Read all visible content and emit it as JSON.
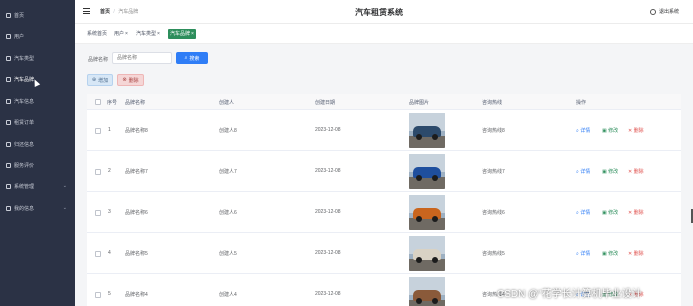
{
  "sidebar": {
    "items": [
      {
        "label": "首页",
        "icon": "home-icon"
      },
      {
        "label": "用户",
        "icon": "user-icon"
      },
      {
        "label": "汽车类型",
        "icon": "grid-icon"
      },
      {
        "label": "汽车品牌",
        "icon": "tag-icon"
      },
      {
        "label": "汽车信息",
        "icon": "grid-icon"
      },
      {
        "label": "租赁订单",
        "icon": "grid-icon"
      },
      {
        "label": "归还信息",
        "icon": "grid-icon"
      },
      {
        "label": "服务评价",
        "icon": "heart-icon"
      },
      {
        "label": "系统管理",
        "icon": "gear-icon"
      },
      {
        "label": "我的信息",
        "icon": "grid-icon"
      }
    ]
  },
  "header": {
    "breadcrumb_home": "首页",
    "breadcrumb_separator": "/",
    "breadcrumb_current": "汽车品牌",
    "app_title": "汽车租赁系统",
    "logout_label": "退出系统"
  },
  "tags": {
    "items": [
      "系统首页",
      "用户",
      "汽车类型",
      "汽车品牌"
    ],
    "close": "×",
    "active_color": "#2d8e5c"
  },
  "search": {
    "label": "品牌名称",
    "placeholder": "品牌名称",
    "button": "搜索"
  },
  "actions": {
    "add": "增加",
    "delete": "删除"
  },
  "table": {
    "columns": [
      "序号",
      "品牌名称",
      "创建人",
      "创建日期",
      "品牌图片",
      "咨询热线",
      "操作"
    ],
    "row_actions": {
      "view": "详情",
      "edit": "修改",
      "delete": "删除"
    },
    "rows": [
      {
        "index": "1",
        "name": "品牌名称8",
        "creator": "创建人8",
        "date": "2023-12-08",
        "hotline": "咨询热线8",
        "car_color": "#2c4a6b"
      },
      {
        "index": "2",
        "name": "品牌名称7",
        "creator": "创建人7",
        "date": "2023-12-08",
        "hotline": "咨询热线7",
        "car_color": "#1f4f9e"
      },
      {
        "index": "3",
        "name": "品牌名称6",
        "creator": "创建人6",
        "date": "2023-12-08",
        "hotline": "咨询热线6",
        "car_color": "#c9651e"
      },
      {
        "index": "4",
        "name": "品牌名称5",
        "creator": "创建人5",
        "date": "2023-12-08",
        "hotline": "咨询热线5",
        "car_color": "#d9d2c4"
      },
      {
        "index": "5",
        "name": "品牌名称4",
        "creator": "创建人4",
        "date": "2023-12-08",
        "hotline": "咨询热线4",
        "car_color": "#8a5a3a"
      }
    ]
  },
  "watermark": "CSDN @“花学长计算机毕业设计"
}
